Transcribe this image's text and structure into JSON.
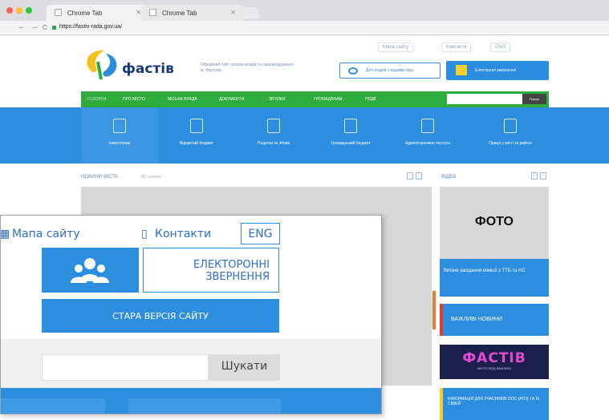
{
  "browser": {
    "tabs": [
      {
        "label": "Chrome Tab",
        "active": true
      },
      {
        "label": "Chrome Tab",
        "active": false
      }
    ],
    "url": "https://fastiv-rada.gov.ua/"
  },
  "site": {
    "top_links": [
      "Мапа сайту",
      "Контакти",
      "ENG"
    ],
    "logo_text": "фастів",
    "logo_subtitle": "Офіційний сайт органів влади та самоврядування м. Фастова",
    "sign_button": "Для людей з вадами зору",
    "appeal_button": "Електронні звернення",
    "nav": [
      "ГОЛОВНА",
      "ПРО МІСТО",
      "МІСЬКА ВЛАДА",
      "ДОКУМЕНТИ",
      "ЗВ'ЯЗКИ",
      "ГРОМАДЯНАМ",
      "ПОДІЇ"
    ],
    "search_button": "Пошук",
    "categories": [
      {
        "label": "Інвесторам",
        "icon": "briefcase-icon"
      },
      {
        "label": "Відкритий бюджет",
        "icon": "document-icon"
      },
      {
        "label": "Податки та збори",
        "icon": "calculator-icon"
      },
      {
        "label": "Громадський бюджет",
        "icon": "money-icon"
      },
      {
        "label": "Адміністративні послуги",
        "icon": "building-icon"
      },
      {
        "label": "Праця у місті та районі",
        "icon": "calendar-icon"
      }
    ],
    "breadcrumb": "НОВИНИ МІСТА",
    "breadcrumb_sub": "Всі новини",
    "video_label": "ВІДЕО",
    "photo_label": "ФОТО",
    "news_blue": "Виїзне засідання комісії з ТТБ та НС",
    "important_news": "ВАЖЛИВІ НОВИНИ",
    "fastiv_banner": "ФАСТІВ",
    "fastiv_banner_sub": "МІСТО КЕДІ ВАЖЛИВІ",
    "info_banner": "ІНФОРМАЦІЯ ДЛЯ УЧАСНИКІВ ООС (АТО) ТА ЇХ СІМЕЙ"
  },
  "zoom": {
    "sitemap": "Мапа сайту",
    "contacts": "Контакти",
    "eng": "ENG",
    "appeal_line1": "ЕЛЕКТОРОННІ",
    "appeal_line2": "ЗВЕРНЕННЯ",
    "old_version": "СТАРА ВЕРСІЯ САЙТУ",
    "search_button": "Шукати"
  },
  "colors": {
    "primary_blue": "#2d8ee0",
    "nav_green": "#2eac3d",
    "accent_yellow": "#f2d22a",
    "accent_red": "#e23a2e"
  }
}
